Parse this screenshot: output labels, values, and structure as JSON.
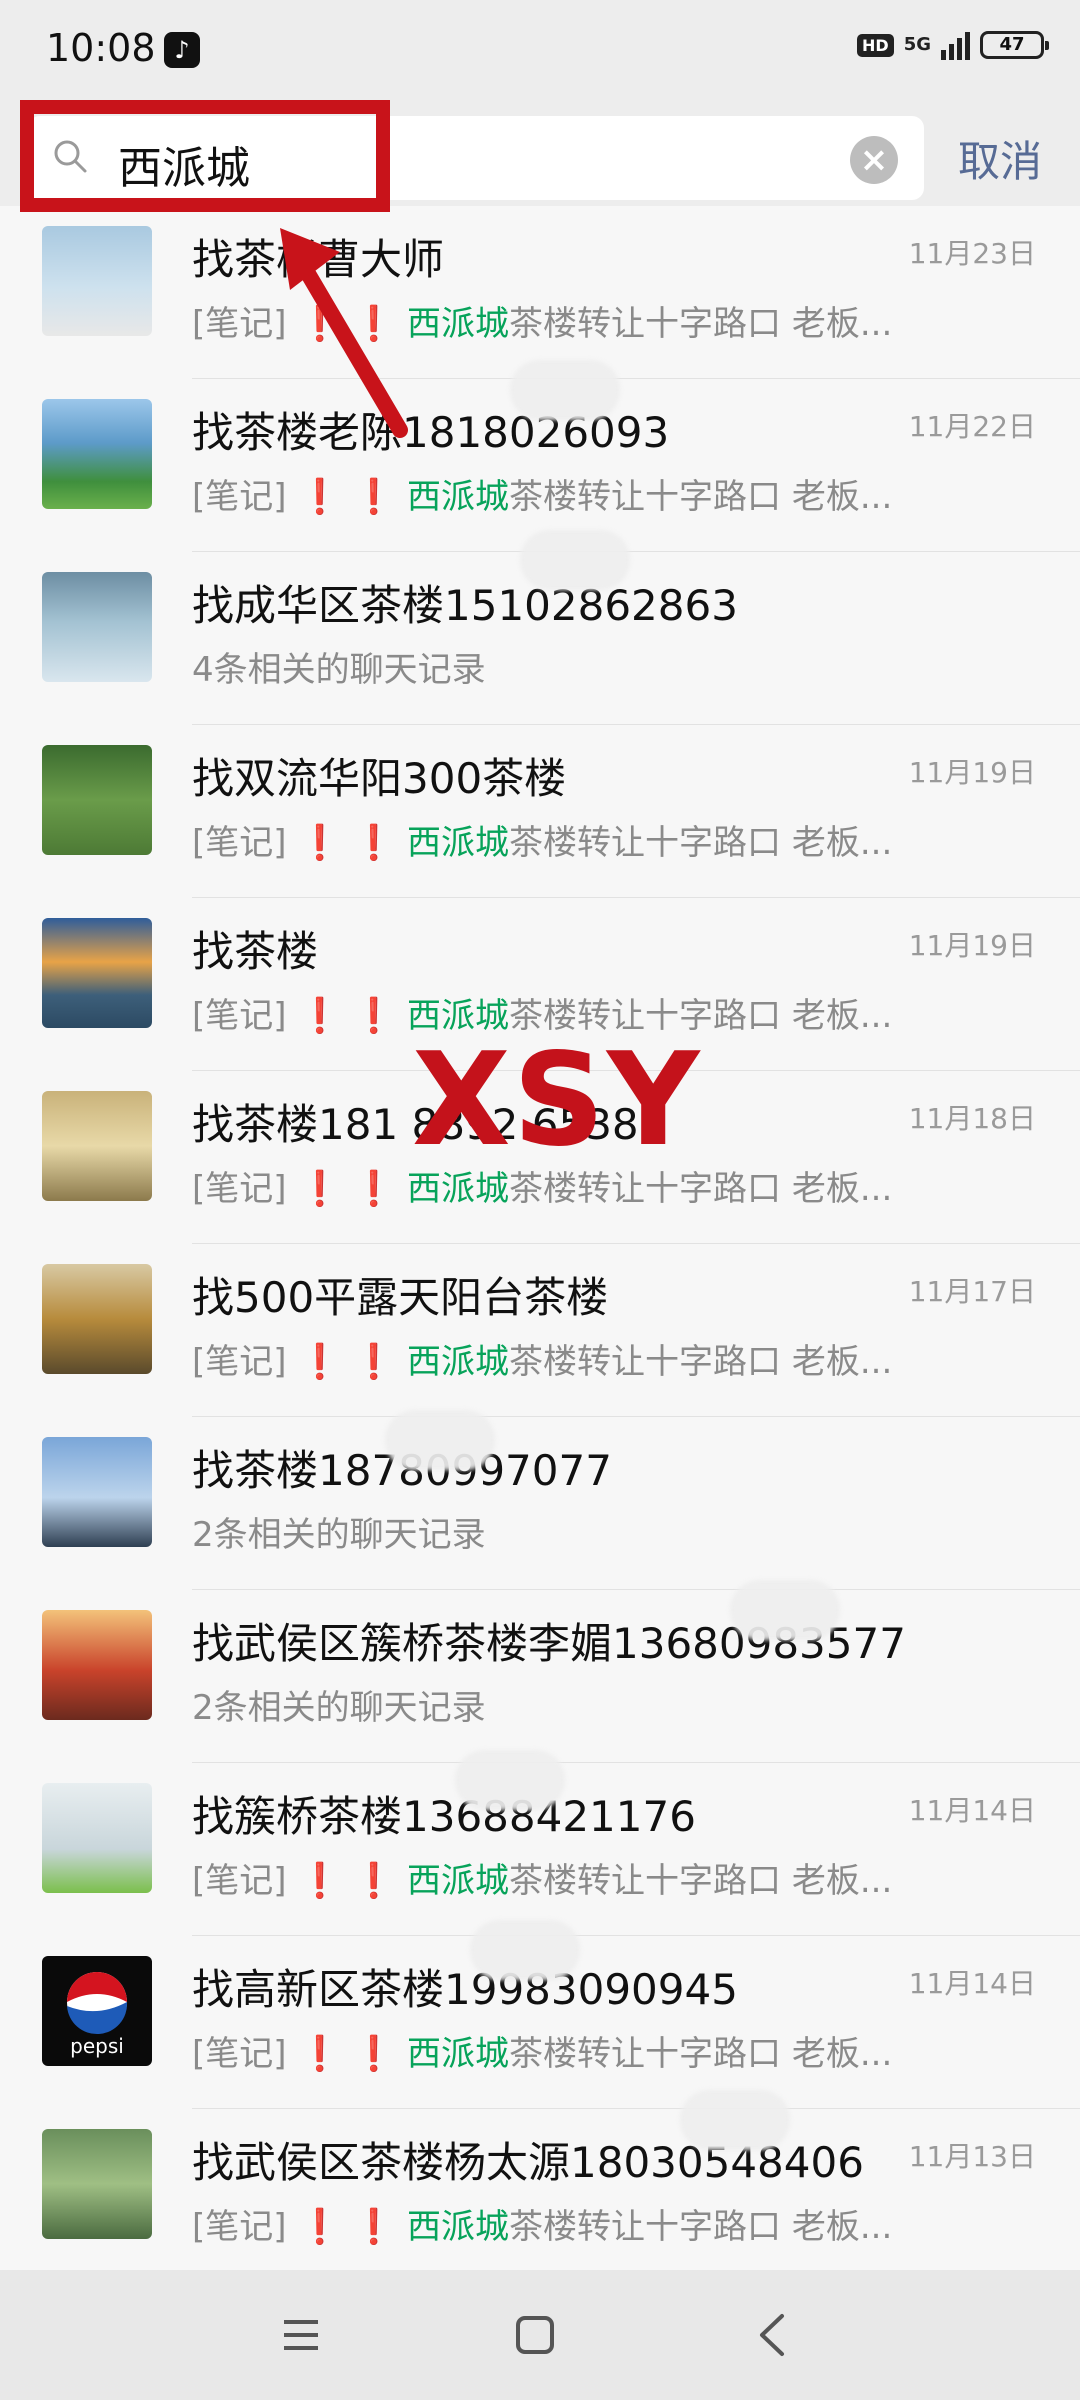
{
  "status_bar": {
    "time": "10:08",
    "network": "5G",
    "hd": "HD",
    "battery": "47"
  },
  "search": {
    "query": "西派城",
    "cancel_label": "取消"
  },
  "watermark": "XSY",
  "results": [
    {
      "title": "找茶楼曹大师",
      "date": "11月23日",
      "sub_prefix": "[笔记]",
      "sub_marks": "❗ ❗",
      "sub_highlight": "西派城",
      "sub_rest": "茶楼转让十字路口 老板..."
    },
    {
      "title": "找茶楼老陈1818026093",
      "date": "11月22日",
      "sub_prefix": "[笔记]",
      "sub_marks": "❗ ❗",
      "sub_highlight": "西派城",
      "sub_rest": "茶楼转让十字路口 老板..."
    },
    {
      "title": "找成华区茶楼15102862863",
      "date": "",
      "sub_prefix": "4条相关的聊天记录",
      "sub_marks": "",
      "sub_highlight": "",
      "sub_rest": ""
    },
    {
      "title": "找双流华阳300茶楼",
      "date": "11月19日",
      "sub_prefix": "[笔记]",
      "sub_marks": "❗ ❗",
      "sub_highlight": "西派城",
      "sub_rest": "茶楼转让十字路口 老板..."
    },
    {
      "title": "找茶楼",
      "date": "11月19日",
      "sub_prefix": "[笔记]",
      "sub_marks": "❗ ❗",
      "sub_highlight": "西派城",
      "sub_rest": "茶楼转让十字路口 老板..."
    },
    {
      "title": "找茶楼181 8892 6538",
      "date": "11月18日",
      "sub_prefix": "[笔记]",
      "sub_marks": "❗ ❗",
      "sub_highlight": "西派城",
      "sub_rest": "茶楼转让十字路口 老板..."
    },
    {
      "title": "找500平露天阳台茶楼",
      "date": "11月17日",
      "sub_prefix": "[笔记]",
      "sub_marks": "❗ ❗",
      "sub_highlight": "西派城",
      "sub_rest": "茶楼转让十字路口 老板..."
    },
    {
      "title": "找茶楼18780997077",
      "date": "",
      "sub_prefix": "2条相关的聊天记录",
      "sub_marks": "",
      "sub_highlight": "",
      "sub_rest": ""
    },
    {
      "title": "找武侯区簇桥茶楼李媚13680983577",
      "date": "",
      "sub_prefix": "2条相关的聊天记录",
      "sub_marks": "",
      "sub_highlight": "",
      "sub_rest": ""
    },
    {
      "title": "找簇桥茶楼13688421176",
      "date": "11月14日",
      "sub_prefix": "[笔记]",
      "sub_marks": "❗ ❗",
      "sub_highlight": "西派城",
      "sub_rest": "茶楼转让十字路口 老板..."
    },
    {
      "title": "找高新区茶楼19983090945",
      "date": "11月14日",
      "sub_prefix": "[笔记]",
      "sub_marks": "❗ ❗",
      "sub_highlight": "西派城",
      "sub_rest": "茶楼转让十字路口 老板..."
    },
    {
      "title": "找武侯区茶楼杨太源18030548406",
      "date": "11月13日",
      "sub_prefix": "[笔记]",
      "sub_marks": "❗ ❗",
      "sub_highlight": "西派城",
      "sub_rest": "茶楼转让十字路口 老板..."
    }
  ],
  "avatar_images": [
    "man-meditating-by-lake",
    "green-island-in-lake",
    "woman-by-lake-sunset",
    "person-on-garden-steps",
    "mountain-lake-sunset",
    "construction-excavator",
    "office-with-flowers",
    "man-standing-by-sea",
    "sunlit-tree-branches",
    "white-vase-with-limes",
    "pepsi-logo",
    "man-in-green-greenhouse"
  ],
  "pepsi_logo_text": "pepsi",
  "colors": {
    "highlight_green": "#07a35a",
    "mark_red": "#d4141f",
    "link_blue": "#576b95",
    "annotation_red": "#c8131a"
  }
}
